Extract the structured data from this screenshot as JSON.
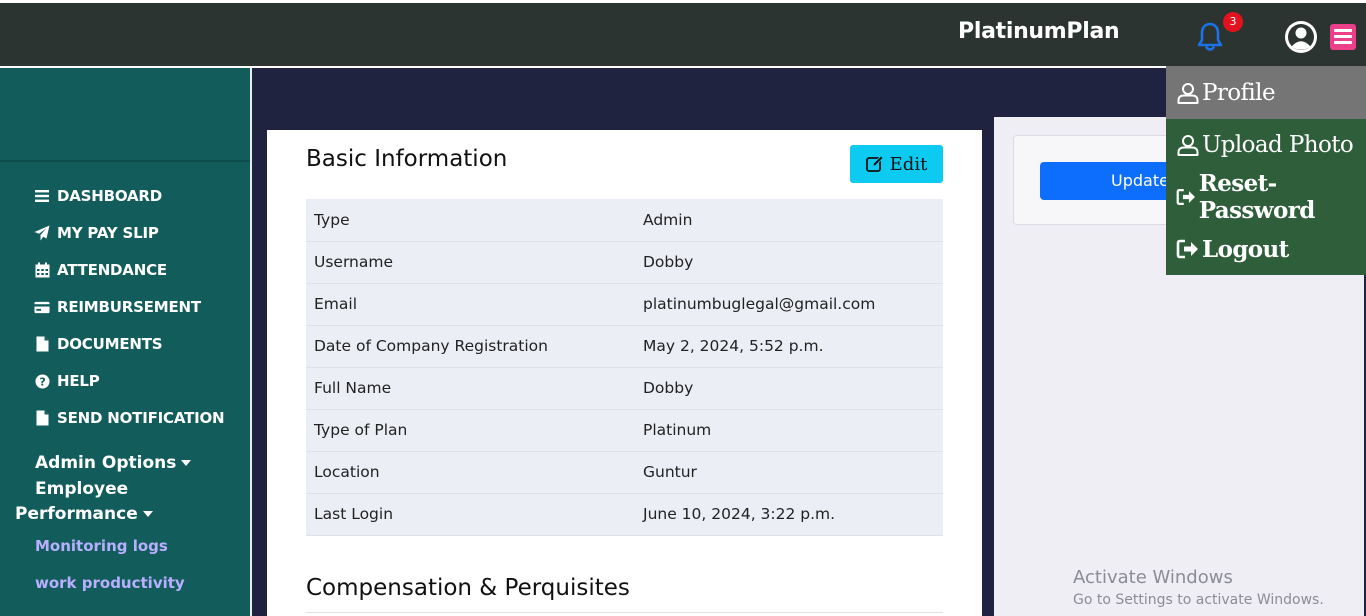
{
  "header": {
    "brand": "PlatinumPlan",
    "notification_count": "3"
  },
  "sidebar": {
    "items": [
      {
        "label": "DASHBOARD",
        "icon": "bars-icon"
      },
      {
        "label": "MY PAY SLIP",
        "icon": "paper-plane-icon"
      },
      {
        "label": "ATTENDANCE",
        "icon": "calendar-icon"
      },
      {
        "label": "REIMBURSEMENT",
        "icon": "credit-card-icon"
      },
      {
        "label": "DOCUMENTS",
        "icon": "file-icon"
      },
      {
        "label": "HELP",
        "icon": "question-circle-icon"
      },
      {
        "label": "SEND NOTIFICATION",
        "icon": "file-icon"
      }
    ],
    "admin_options": "Admin Options",
    "employee_performance_line1": "Employee",
    "employee_performance_line2": "Performance",
    "sub_links": [
      "Monitoring logs",
      "work productivity"
    ]
  },
  "basic_info": {
    "title": "Basic Information",
    "edit_label": "Edit",
    "rows": [
      {
        "label": "Type",
        "value": "Admin"
      },
      {
        "label": "Username",
        "value": "Dobby"
      },
      {
        "label": "Email",
        "value": "platinumbuglegal@gmail.com"
      },
      {
        "label": "Date of Company Registration",
        "value": "May 2, 2024, 5:52 p.m."
      },
      {
        "label": "Full Name",
        "value": "Dobby"
      },
      {
        "label": "Type of Plan",
        "value": "Platinum"
      },
      {
        "label": "Location",
        "value": "Guntur"
      },
      {
        "label": "Last Login",
        "value": "June 10, 2024, 3:22 p.m."
      }
    ],
    "compensation_title": "Compensation & Perquisites"
  },
  "right_panel": {
    "update_label": "Update"
  },
  "profile_menu": {
    "items": [
      {
        "label": "Profile",
        "icon": "user-outline-icon"
      },
      {
        "label": "Upload Photo",
        "icon": "user-outline-icon"
      },
      {
        "label": "Reset-Password",
        "icon": "sign-out-icon"
      },
      {
        "label": "Logout",
        "icon": "sign-out-icon"
      }
    ]
  },
  "watermark": {
    "title": "Activate Windows",
    "subtitle": "Go to Settings to activate Windows."
  },
  "colors": {
    "topbar": "#2b3431",
    "sidebar": "#135c5c",
    "accent_edit": "#0dcaf0",
    "accent_update": "#0d6efd",
    "menu_button": "#ec3f8a",
    "dropdown_green": "#2e5e3a",
    "dropdown_active": "#757575",
    "badge": "#e2131e"
  }
}
